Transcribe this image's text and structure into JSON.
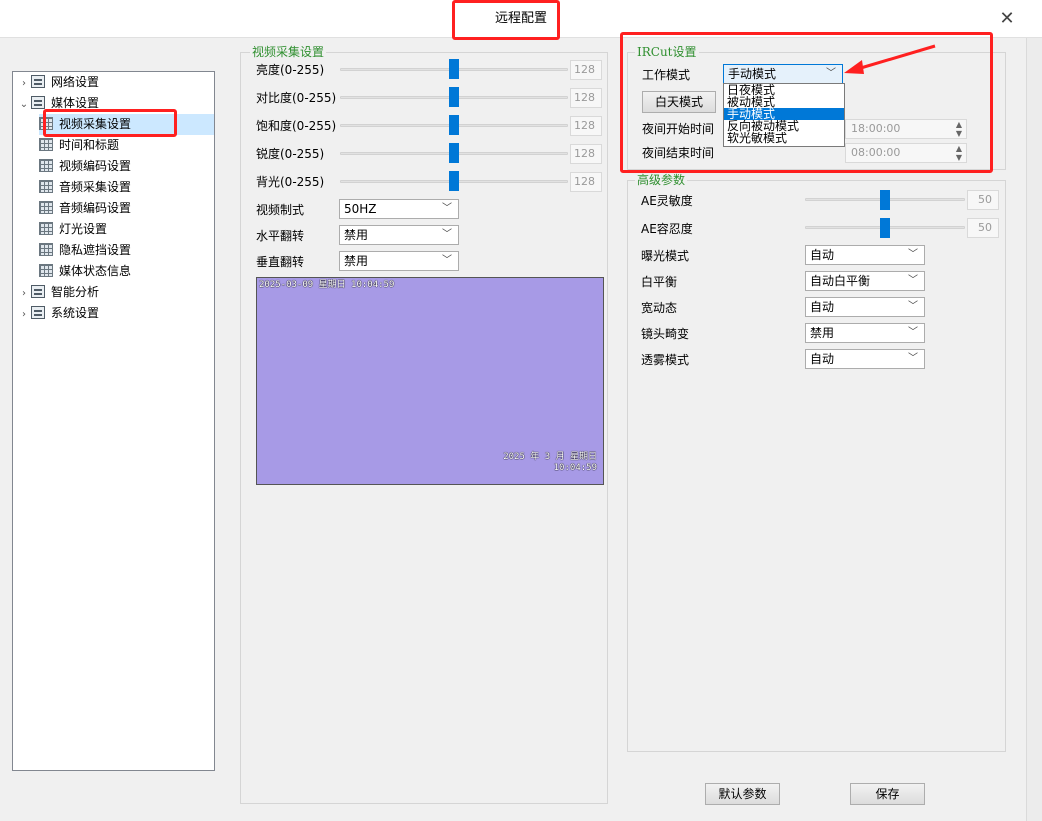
{
  "window": {
    "title": "远程配置"
  },
  "tree": {
    "items": [
      {
        "label": "网络设置",
        "arrow": "›",
        "icon": "server-icon",
        "level": 0
      },
      {
        "label": "媒体设置",
        "arrow": "⌄",
        "icon": "server-icon",
        "level": 0
      },
      {
        "label": "视频采集设置",
        "arrow": "",
        "icon": "grid-icon",
        "level": 1,
        "selected": true
      },
      {
        "label": "时间和标题",
        "arrow": "",
        "icon": "grid-icon",
        "level": 1
      },
      {
        "label": "视频编码设置",
        "arrow": "",
        "icon": "grid-icon",
        "level": 1
      },
      {
        "label": "音频采集设置",
        "arrow": "",
        "icon": "grid-icon",
        "level": 1
      },
      {
        "label": "音频编码设置",
        "arrow": "",
        "icon": "grid-icon",
        "level": 1
      },
      {
        "label": "灯光设置",
        "arrow": "",
        "icon": "grid-icon",
        "level": 1
      },
      {
        "label": "隐私遮挡设置",
        "arrow": "",
        "icon": "grid-icon",
        "level": 1
      },
      {
        "label": "媒体状态信息",
        "arrow": "",
        "icon": "grid-icon",
        "level": 1
      },
      {
        "label": "智能分析",
        "arrow": "›",
        "icon": "server-icon",
        "level": 0
      },
      {
        "label": "系统设置",
        "arrow": "›",
        "icon": "server-icon",
        "level": 0
      }
    ]
  },
  "video_capture": {
    "title": "视频采集设置",
    "sliders": [
      {
        "label": "亮度(0-255)",
        "value": "128",
        "fraction": 0.5
      },
      {
        "label": "对比度(0-255)",
        "value": "128",
        "fraction": 0.5
      },
      {
        "label": "饱和度(0-255)",
        "value": "128",
        "fraction": 0.5
      },
      {
        "label": "锐度(0-255)",
        "value": "128",
        "fraction": 0.5
      },
      {
        "label": "背光(0-255)",
        "value": "128",
        "fraction": 0.5
      }
    ],
    "video_standard": {
      "label": "视频制式",
      "value": "50HZ"
    },
    "horizontal_flip": {
      "label": "水平翻转",
      "value": "禁用"
    },
    "vertical_flip": {
      "label": "垂直翻转",
      "value": "禁用"
    },
    "preview": {
      "osd_top": "2025-03-09 星期日 10:04:59",
      "osd_bottom_line1": "2025 年 3 月 星期日",
      "osd_bottom_line2": "10:04:59"
    }
  },
  "ircut": {
    "title": "IRCut设置",
    "work_mode": {
      "label": "工作模式",
      "value": "手动模式"
    },
    "day_mode_button": "白天模式",
    "night_start": {
      "label": "夜间开始时间",
      "value": "18:00:00"
    },
    "night_end": {
      "label": "夜间结束时间",
      "value": "08:00:00"
    },
    "dropdown_options": [
      "日夜模式",
      "被动模式",
      "手动模式",
      "反向被动模式",
      "软光敏模式"
    ],
    "dropdown_highlighted": "手动模式"
  },
  "advanced": {
    "title": "高级参数",
    "ae_sensitivity": {
      "label": "AE灵敏度",
      "value": "50",
      "fraction": 0.5
    },
    "ae_tolerance": {
      "label": "AE容忍度",
      "value": "50",
      "fraction": 0.5
    },
    "exposure_mode": {
      "label": "曝光模式",
      "value": "自动"
    },
    "white_balance": {
      "label": "白平衡",
      "value": "自动白平衡"
    },
    "wdr": {
      "label": "宽动态",
      "value": "自动"
    },
    "lens_distortion": {
      "label": "镜头畸变",
      "value": "禁用"
    },
    "defog_mode": {
      "label": "透雾模式",
      "value": "自动"
    }
  },
  "footer": {
    "default_button": "默认参数",
    "save_button": "保存"
  },
  "colors": {
    "accent": "#0078d7",
    "group_title": "#2f8f2f",
    "annotation_red": "#ff2020"
  }
}
